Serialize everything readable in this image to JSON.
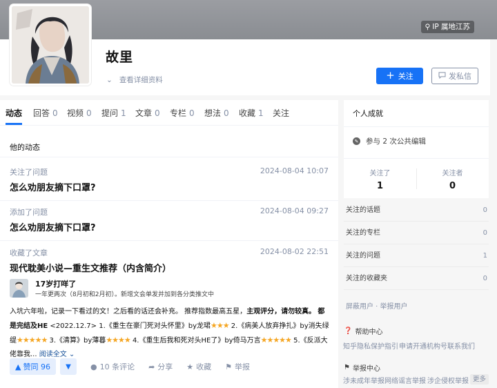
{
  "profile": {
    "ip_location": "IP 属地江苏",
    "name": "故里",
    "detail_link": "查看详细资料",
    "follow_label": "关注",
    "message_label": "发私信"
  },
  "tabs": [
    {
      "label": "动态",
      "count": ""
    },
    {
      "label": "回答",
      "count": "0"
    },
    {
      "label": "视频",
      "count": "0"
    },
    {
      "label": "提问",
      "count": "1"
    },
    {
      "label": "文章",
      "count": "0"
    },
    {
      "label": "专栏",
      "count": "0"
    },
    {
      "label": "想法",
      "count": "0"
    },
    {
      "label": "收藏",
      "count": "1"
    },
    {
      "label": "关注",
      "count": ""
    }
  ],
  "feed": {
    "section_title": "他的动态",
    "items": [
      {
        "action": "关注了问题",
        "time": "2024-08-04 10:07",
        "title": "怎么劝朋友摘下口罩?"
      },
      {
        "action": "添加了问题",
        "time": "2024-08-04 09:27",
        "title": "怎么劝朋友摘下口罩?"
      },
      {
        "action": "收藏了文章",
        "time": "2024-08-02 22:51",
        "title": "现代耽美小说—重生文推荐（内含简介）"
      }
    ],
    "article": {
      "author_name": "17岁打咩了",
      "author_bio": "一年更两次（8月初和2月初）。新增文会单发并加到各分类推文中",
      "excerpt_1": "入坑六年啦，记录一下看过的文！之后看的话还会补充。 推荐指数最高五星，",
      "excerpt_bold_1": "主观评分，请勿较真。",
      "excerpt_bold_2": "都是完结及HE",
      "excerpt_2": " <2022.12.7> 1.《重生在豪门死对头怀里》by龙珺",
      "excerpt_3": " 2.《病美人放弃挣扎》by消失绿缇",
      "excerpt_4": " 3.《清算》by薄暮",
      "excerpt_5": " 4.《重生后我和死对头HE了》by倚马万言",
      "excerpt_6": " 5.《反派大佬靠我...",
      "read_more": "阅读全文",
      "upvote": "赞同 96",
      "comments": "10 条评论",
      "share": "分享",
      "collect": "收藏",
      "report": "举报"
    }
  },
  "sidebar": {
    "achievement_title": "个人成就",
    "achievement_item": "参与 2 次公共编辑",
    "following_label": "关注了",
    "following_count": "1",
    "followers_label": "关注者",
    "followers_count": "0",
    "lists": [
      {
        "label": "关注的话题",
        "count": "0"
      },
      {
        "label": "关注的专栏",
        "count": "0"
      },
      {
        "label": "关注的问题",
        "count": "1"
      },
      {
        "label": "关注的收藏夹",
        "count": "0"
      }
    ],
    "block_report": "屏蔽用户 · 举报用户",
    "help_center": "帮助中心",
    "help_links": [
      "知乎隐私保护指引",
      "申请开通机构号",
      "联系我们"
    ],
    "report_center": "举报中心",
    "report_links": [
      "涉未成年举报",
      "网络谣言举报",
      "涉企侵权举报"
    ],
    "more": "更多"
  },
  "colors": {
    "brand": "#1772f6",
    "muted": "#8590a6",
    "star": "#f5a623"
  }
}
